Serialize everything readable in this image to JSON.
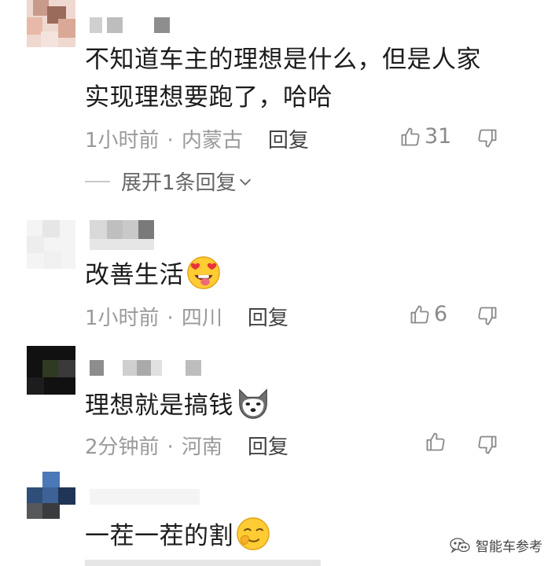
{
  "comments": [
    {
      "text_line1": "不知道车主的理想是什么，但是人家",
      "text_line2": "实现理想要跑了，哈哈",
      "time": "1小时前",
      "location": "内蒙古",
      "reply_label": "回复",
      "like_count": "31",
      "expand_label": "展开1条回复"
    },
    {
      "text": "改善生活",
      "emoji": "heart-eyes-emoji",
      "time": "1小时前",
      "location": "四川",
      "reply_label": "回复",
      "like_count": "6"
    },
    {
      "text": "理想就是搞钱",
      "emoji": "husky-emoji",
      "time": "2分钟前",
      "location": "河南",
      "reply_label": "回复",
      "like_count": ""
    },
    {
      "text": "一茬一茬的割",
      "emoji": "smirk-emoji"
    }
  ],
  "watermark": {
    "label": "智能车参考"
  },
  "separator": "·",
  "colors": {
    "meta": "#9a9a9a",
    "text": "#1c1c1c",
    "reply": "#444444"
  }
}
